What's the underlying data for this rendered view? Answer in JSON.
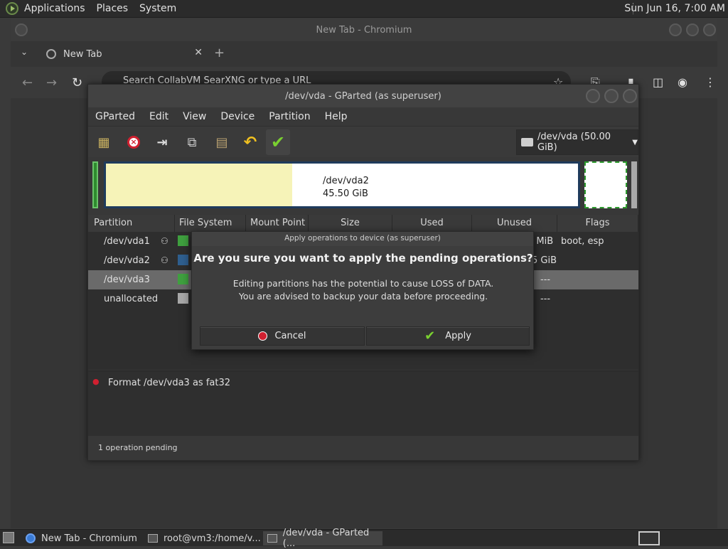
{
  "top_panel": {
    "menus": [
      "Applications",
      "Places",
      "System"
    ],
    "clock": "Sun Jun 16,  7:00 AM"
  },
  "chrome": {
    "window_title": "New Tab - Chromium",
    "tab_label": "New Tab",
    "omnibox_placeholder": "Search CollabVM SearXNG or type a URL"
  },
  "gparted": {
    "window_title": "/dev/vda - GParted (as superuser)",
    "menu": [
      "GParted",
      "Edit",
      "View",
      "Device",
      "Partition",
      "Help"
    ],
    "device_select": "/dev/vda (50.00 GiB)",
    "map": {
      "name": "/dev/vda2",
      "size": "45.50 GiB"
    },
    "columns": [
      "Partition",
      "File System",
      "Mount Point",
      "Size",
      "Used",
      "Unused",
      "Flags"
    ],
    "rows": [
      {
        "partition": "/dev/vda1",
        "fs_color": "#3fa03f",
        "unused_tail": "0 MiB",
        "flags": "boot, esp",
        "key": true
      },
      {
        "partition": "/dev/vda2",
        "fs_color": "#2f5f8f",
        "unused_tail": "5 GiB",
        "flags": "",
        "key": true
      },
      {
        "partition": "/dev/vda3",
        "fs_color": "#3fa03f",
        "unused_tail": "---",
        "flags": "",
        "key": false
      },
      {
        "partition": "unallocated",
        "fs_color": "#a8a8a8",
        "fs_label": "u",
        "unused_tail": "---",
        "flags": "",
        "key": false
      }
    ],
    "operation": "Format /dev/vda3 as fat32",
    "status": "1 operation pending"
  },
  "dialog": {
    "title": "Apply operations to device (as superuser)",
    "question": "Are you sure you want to apply the pending operations?",
    "message_line1": "Editing partitions has the potential to cause LOSS of DATA.",
    "message_line2": "You are advised to backup your data before proceeding.",
    "cancel_label": "Cancel",
    "apply_label": "Apply"
  },
  "taskbar": {
    "tasks": [
      "New Tab - Chromium",
      "root@vm3:/home/v...",
      "/dev/vda - GParted (..."
    ]
  }
}
